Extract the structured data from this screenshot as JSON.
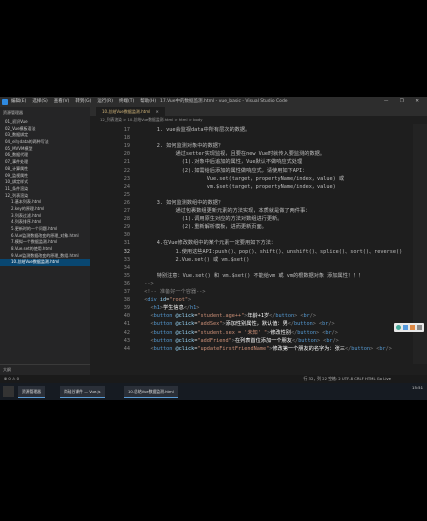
{
  "menubar": {
    "items": [
      "编辑(E)",
      "选择(S)",
      "查看(V)",
      "转到(G)",
      "运行(R)",
      "终端(T)",
      "帮助(H)"
    ],
    "title": "17.Vue中的数据监测.html - vue_basic - Visual Studio Code",
    "window_controls": "— ❐ ✕"
  },
  "sidebar": {
    "header": "资源管理器",
    "items": [
      {
        "label": "01_初识Vue",
        "active": false,
        "sub": false
      },
      {
        "label": "02_Vue模板语法",
        "active": false,
        "sub": false
      },
      {
        "label": "03_数据绑定",
        "active": false,
        "sub": false
      },
      {
        "label": "04_el与data的两种写法",
        "active": false,
        "sub": false
      },
      {
        "label": "05_MVVM模型",
        "active": false,
        "sub": false
      },
      {
        "label": "06_数据代理",
        "active": false,
        "sub": false
      },
      {
        "label": "07_事件处理",
        "active": false,
        "sub": false
      },
      {
        "label": "08_计算属性",
        "active": false,
        "sub": false
      },
      {
        "label": "09_监视属性",
        "active": false,
        "sub": false
      },
      {
        "label": "10_绑定样式",
        "active": false,
        "sub": false
      },
      {
        "label": "11_条件渲染",
        "active": false,
        "sub": false
      },
      {
        "label": "12_列表渲染",
        "active": false,
        "sub": false
      },
      {
        "label": "1.基本列表.html",
        "active": false,
        "sub": true
      },
      {
        "label": "2.key的原理.html",
        "active": false,
        "sub": true
      },
      {
        "label": "3.列表过滤.html",
        "active": false,
        "sub": true
      },
      {
        "label": "4.列表排序.html",
        "active": false,
        "sub": true
      },
      {
        "label": "5.更新时的一个问题.html",
        "active": false,
        "sub": true
      },
      {
        "label": "6.Vue监测数据改变的原理_对象.html",
        "active": false,
        "sub": true
      },
      {
        "label": "7.模拟一个数据监测.html",
        "active": false,
        "sub": true
      },
      {
        "label": "8.Vue.set的使用.html",
        "active": false,
        "sub": true
      },
      {
        "label": "9.Vue监测数据改变的原理_数组.html",
        "active": false,
        "sub": true
      },
      {
        "label": "10.总结Vue数据监测.html",
        "active": true,
        "sub": true
      }
    ],
    "outline": "大纲"
  },
  "tab": {
    "label": "10.总结Vue数据监测.html",
    "close": "✕"
  },
  "breadcrumb": "12_列表渲染 > 10.总结Vue数据监测.html > html > body",
  "editor": {
    "lines": [
      {
        "n": "17",
        "segs": [
          {
            "c": "cm",
            "t": "      1. vue会监视data中所有层次的数据。"
          }
        ]
      },
      {
        "n": "18",
        "segs": []
      },
      {
        "n": "19",
        "segs": [
          {
            "c": "cm",
            "t": "      2. 如何监测对象中的数据？"
          }
        ]
      },
      {
        "n": "20",
        "segs": [
          {
            "c": "cm",
            "t": "            通过setter实现监视，且要在new Vue时就传入要监测的数据。"
          }
        ]
      },
      {
        "n": "21",
        "segs": [
          {
            "c": "cm",
            "t": "              (1).对象中后追加的属性，Vue默认不做响应式处理"
          }
        ]
      },
      {
        "n": "22",
        "segs": [
          {
            "c": "cm",
            "t": "              (2).如需给后添加的属性做响应式，请使用如下API："
          }
        ]
      },
      {
        "n": "23",
        "segs": [
          {
            "c": "cm",
            "t": "                      Vue.set(target，propertyName/index，value) 或"
          }
        ]
      },
      {
        "n": "24",
        "segs": [
          {
            "c": "cm",
            "t": "                      vm.$set(target，propertyName/index，value)"
          }
        ]
      },
      {
        "n": "25",
        "segs": []
      },
      {
        "n": "26",
        "segs": [
          {
            "c": "cm",
            "t": "      3. 如何监测数组中的数据？"
          }
        ]
      },
      {
        "n": "27",
        "segs": [
          {
            "c": "cm",
            "t": "            通过包裹数组更新元素的方法实现，本质就是做了两件事："
          }
        ]
      },
      {
        "n": "28",
        "segs": [
          {
            "c": "cm",
            "t": "              (1).调用原生对应的方法对数组进行更新。"
          }
        ]
      },
      {
        "n": "29",
        "segs": [
          {
            "c": "cm",
            "t": "              (2).重新解析模板，进而更新页面。"
          }
        ]
      },
      {
        "n": "30",
        "segs": []
      },
      {
        "n": "31",
        "segs": [
          {
            "c": "cm",
            "t": "      4.在Vue修改数组中的某个元素一定要用如下方法："
          }
        ]
      },
      {
        "n": "32",
        "segs": [
          {
            "c": "cm",
            "t": "            1.使用这些API:push()、pop()、shift()、unshift()、splice()、sort()、reverse()"
          }
        ],
        "cur": true
      },
      {
        "n": "33",
        "segs": [
          {
            "c": "cm",
            "t": "            2.Vue.set() 或 vm.$set()"
          }
        ]
      },
      {
        "n": "34",
        "segs": []
      },
      {
        "n": "35",
        "segs": [
          {
            "c": "cm",
            "t": "      特别注意：Vue.set() 和 vm.$set() 不能给vm 或 vm的根数据对象 添加属性！！！"
          }
        ]
      },
      {
        "n": "36",
        "segs": [
          {
            "c": "pu",
            "t": "  -->"
          }
        ]
      },
      {
        "n": "37",
        "segs": [
          {
            "c": "pu",
            "t": "  <!-- 准备好一个容器-->"
          }
        ]
      },
      {
        "n": "38",
        "segs": [
          {
            "c": "pu",
            "t": "  <"
          },
          {
            "c": "t",
            "t": "div"
          },
          {
            "c": "at",
            "t": " id"
          },
          {
            "c": "c",
            "t": "="
          },
          {
            "c": "st",
            "t": "\"root\""
          },
          {
            "c": "pu",
            "t": ">"
          }
        ]
      },
      {
        "n": "39",
        "segs": [
          {
            "c": "pu",
            "t": "    <"
          },
          {
            "c": "t",
            "t": "h1"
          },
          {
            "c": "pu",
            "t": ">"
          },
          {
            "c": "tx",
            "t": "学生信息"
          },
          {
            "c": "pu",
            "t": "</"
          },
          {
            "c": "t",
            "t": "h1"
          },
          {
            "c": "pu",
            "t": ">"
          }
        ]
      },
      {
        "n": "40",
        "segs": [
          {
            "c": "pu",
            "t": "    <"
          },
          {
            "c": "t",
            "t": "button"
          },
          {
            "c": "at",
            "t": " @click"
          },
          {
            "c": "c",
            "t": "="
          },
          {
            "c": "st",
            "t": "\"student.age++\""
          },
          {
            "c": "pu",
            "t": ">"
          },
          {
            "c": "tx",
            "t": "年龄+1岁"
          },
          {
            "c": "pu",
            "t": "</"
          },
          {
            "c": "t",
            "t": "button"
          },
          {
            "c": "pu",
            "t": "> <"
          },
          {
            "c": "t",
            "t": "br"
          },
          {
            "c": "pu",
            "t": "/>"
          }
        ]
      },
      {
        "n": "41",
        "segs": [
          {
            "c": "pu",
            "t": "    <"
          },
          {
            "c": "t",
            "t": "button"
          },
          {
            "c": "at",
            "t": " @click"
          },
          {
            "c": "c",
            "t": "="
          },
          {
            "c": "st",
            "t": "\"addSex\""
          },
          {
            "c": "pu",
            "t": ">"
          },
          {
            "c": "tx",
            "t": "添加性别属性，默认值：男"
          },
          {
            "c": "pu",
            "t": "</"
          },
          {
            "c": "t",
            "t": "button"
          },
          {
            "c": "pu",
            "t": "> <"
          },
          {
            "c": "t",
            "t": "br"
          },
          {
            "c": "pu",
            "t": "/>"
          }
        ]
      },
      {
        "n": "42",
        "segs": [
          {
            "c": "pu",
            "t": "    <"
          },
          {
            "c": "t",
            "t": "button"
          },
          {
            "c": "at",
            "t": " @click"
          },
          {
            "c": "c",
            "t": "="
          },
          {
            "c": "st",
            "t": "\"student.sex = '未知' \""
          },
          {
            "c": "pu",
            "t": ">"
          },
          {
            "c": "tx",
            "t": "修改性别"
          },
          {
            "c": "pu",
            "t": "</"
          },
          {
            "c": "t",
            "t": "button"
          },
          {
            "c": "pu",
            "t": "> <"
          },
          {
            "c": "t",
            "t": "br"
          },
          {
            "c": "pu",
            "t": "/>"
          }
        ]
      },
      {
        "n": "43",
        "segs": [
          {
            "c": "pu",
            "t": "    <"
          },
          {
            "c": "t",
            "t": "button"
          },
          {
            "c": "at",
            "t": " @click"
          },
          {
            "c": "c",
            "t": "="
          },
          {
            "c": "st",
            "t": "\"addFriend\""
          },
          {
            "c": "pu",
            "t": ">"
          },
          {
            "c": "tx",
            "t": "在列表首位添加一个朋友"
          },
          {
            "c": "pu",
            "t": "</"
          },
          {
            "c": "t",
            "t": "button"
          },
          {
            "c": "pu",
            "t": "> <"
          },
          {
            "c": "t",
            "t": "br"
          },
          {
            "c": "pu",
            "t": "/>"
          }
        ]
      },
      {
        "n": "44",
        "segs": [
          {
            "c": "pu",
            "t": "    <"
          },
          {
            "c": "t",
            "t": "button"
          },
          {
            "c": "at",
            "t": " @click"
          },
          {
            "c": "c",
            "t": "="
          },
          {
            "c": "st",
            "t": "\"updateFirstFriendName\""
          },
          {
            "c": "pu",
            "t": ">"
          },
          {
            "c": "tx",
            "t": "修改第一个朋友的名字为：张三"
          },
          {
            "c": "pu",
            "t": "</"
          },
          {
            "c": "t",
            "t": "button"
          },
          {
            "c": "pu",
            "t": "> <"
          },
          {
            "c": "t",
            "t": "br"
          },
          {
            "c": "pu",
            "t": "/>"
          }
        ]
      }
    ]
  },
  "statusbar": {
    "left": "⊗ 0 ⚠ 0",
    "right": "行 32，列 22   空格: 2   UTF-8   CRLF   HTML   Go Live"
  },
  "taskbar": {
    "items": [
      "资源管理器",
      "尚硅谷课件 — Vue.js",
      "10.总结Vue数据监测.html"
    ],
    "clock": "15:51"
  },
  "colors": {
    "accent": "#094771",
    "background": "#1e1e1e",
    "sidebar": "#252526"
  }
}
